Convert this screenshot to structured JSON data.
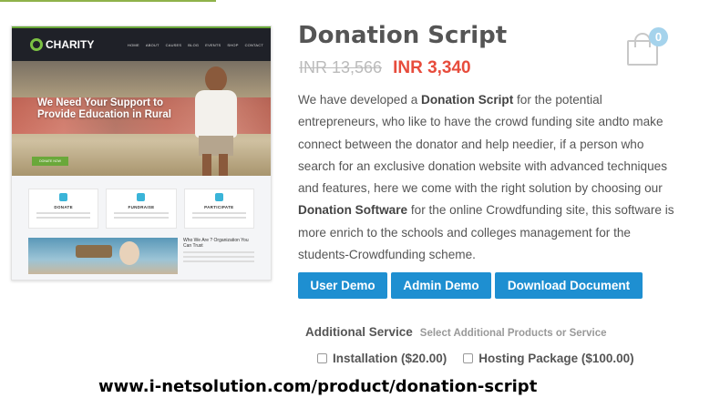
{
  "product": {
    "title": "Donation Script",
    "old_price": "INR 13,566",
    "new_price": "INR 3,340",
    "description": {
      "p1": "We have developed a ",
      "b1": "Donation Script",
      "p2": " for the potential entrepreneurs, who like to have the crowd funding site andto make connect between the donator and help needier, if a person who search for an exclusive donation website with advanced techniques and features, here we come with the right solution by choosing our ",
      "b2": "Donation Software",
      "p3": " for the online Crowdfunding site, this software is more enrich to the schools and colleges management for the students-Crowdfunding scheme."
    }
  },
  "cart": {
    "count": "0",
    "icon": "shopping-bag-icon"
  },
  "buttons": {
    "user_demo": "User Demo",
    "admin_demo": "Admin Demo",
    "download": "Download Document"
  },
  "additional": {
    "heading": "Additional Service",
    "subheading": "Select Additional Products or Service",
    "options": [
      {
        "label": "Installation ($20.00)",
        "checked": false
      },
      {
        "label": "Hosting Package ($100.00)",
        "checked": false
      }
    ]
  },
  "thumbnail": {
    "logo": "CHARITY",
    "menu": [
      "HOME",
      "ABOUT",
      "CAUSES",
      "BLOG",
      "EVENTS",
      "SHOP",
      "CONTACT"
    ],
    "hero_text": "We Need Your Support to Provide Education in Rural",
    "hero_button": "DONATE NOW",
    "cards": [
      "DONATE",
      "FUNDRAISE",
      "PARTICIPATE"
    ],
    "who_title": "Who We Are ? Organization You Can Trust"
  },
  "footer_url": "www.i-netsolution.com/product/donation-script",
  "colors": {
    "accent": "#1e8fd1",
    "price": "#e74c3c",
    "badge": "#a5d3ec"
  }
}
